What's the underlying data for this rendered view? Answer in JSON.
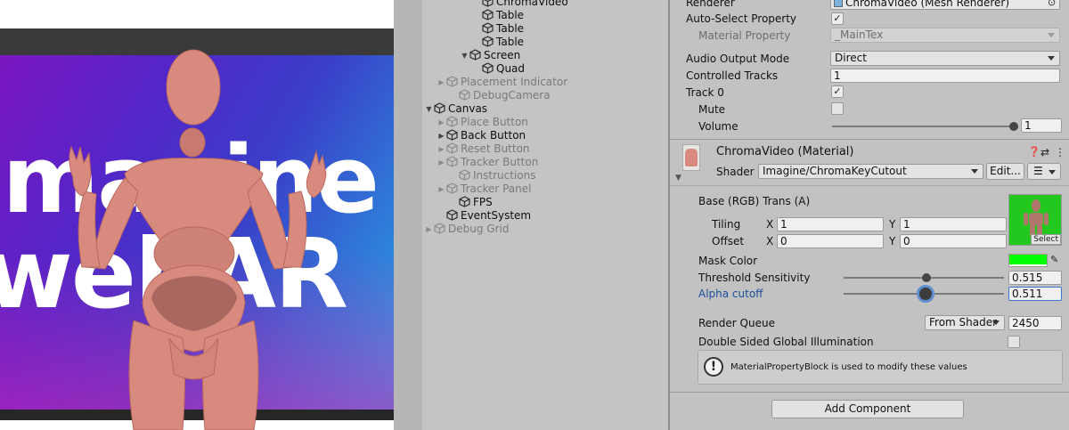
{
  "scene": {
    "overlay_text_line1": "Imagine",
    "overlay_text_line2": "webAR"
  },
  "hierarchy": {
    "items": [
      {
        "label": "ChromaVideo",
        "disabled": false,
        "arrow": "",
        "icon": "cube-icon"
      },
      {
        "label": "Table",
        "disabled": false,
        "arrow": "",
        "icon": "cube-icon"
      },
      {
        "label": "Table",
        "disabled": false,
        "arrow": "",
        "icon": "cube-icon"
      },
      {
        "label": "Table",
        "disabled": false,
        "arrow": "",
        "icon": "cube-icon"
      },
      {
        "label": "Screen",
        "disabled": false,
        "arrow": "expanded",
        "icon": "cube-icon"
      },
      {
        "label": "Quad",
        "disabled": false,
        "arrow": "",
        "icon": "cube-icon"
      },
      {
        "label": "Placement Indicator",
        "disabled": true,
        "arrow": "collapsed",
        "icon": "cube-icon"
      },
      {
        "label": "DebugCamera",
        "disabled": true,
        "arrow": "",
        "icon": "cube-icon"
      },
      {
        "label": "Canvas",
        "disabled": false,
        "arrow": "expanded",
        "icon": "cube-icon"
      },
      {
        "label": "Place Button",
        "disabled": true,
        "arrow": "collapsed",
        "icon": "cube-icon"
      },
      {
        "label": "Back Button",
        "disabled": false,
        "arrow": "collapsed",
        "icon": "cube-icon"
      },
      {
        "label": "Reset Button",
        "disabled": true,
        "arrow": "collapsed",
        "icon": "cube-icon"
      },
      {
        "label": "Tracker Button",
        "disabled": true,
        "arrow": "collapsed",
        "icon": "cube-icon"
      },
      {
        "label": "Instructions",
        "disabled": true,
        "arrow": "",
        "icon": "cube-icon"
      },
      {
        "label": "Tracker Panel",
        "disabled": true,
        "arrow": "collapsed",
        "icon": "cube-icon"
      },
      {
        "label": "FPS",
        "disabled": false,
        "arrow": "",
        "icon": "cube-icon"
      },
      {
        "label": "EventSystem",
        "disabled": false,
        "arrow": "",
        "icon": "cube-icon"
      },
      {
        "label": "Debug Grid",
        "disabled": true,
        "arrow": "collapsed",
        "icon": "cube-icon"
      }
    ]
  },
  "inspector": {
    "renderer_label": "Renderer",
    "renderer_value": "ChromaVideo (Mesh Renderer)",
    "auto_select_label": "Auto-Select Property",
    "auto_select_checked": true,
    "material_property_label": "Material Property",
    "material_property_value": "_MainTex",
    "audio_output_label": "Audio Output Mode",
    "audio_output_value": "Direct",
    "controlled_tracks_label": "Controlled Tracks",
    "controlled_tracks_value": "1",
    "track0_label": "Track 0",
    "track0_checked": true,
    "mute_label": "Mute",
    "mute_checked": false,
    "volume_label": "Volume",
    "volume_value": "1",
    "volume_level": 1.0,
    "material_title": "ChromaVideo (Material)",
    "shader_label": "Shader",
    "shader_value": "Imagine/ChromaKeyCutout",
    "edit_button": "Edit...",
    "base_label": "Base (RGB) Trans (A)",
    "tiling_label": "Tiling",
    "tiling_x": "1",
    "tiling_y": "1",
    "offset_label": "Offset",
    "offset_x": "0",
    "offset_y": "0",
    "x_label": "X",
    "y_label": "Y",
    "select_button": "Select",
    "mask_color_label": "Mask Color",
    "mask_color": "#00ff00",
    "threshold_label": "Threshold Sensitivity",
    "threshold_value": "0.515",
    "threshold_level": 0.515,
    "alpha_cutoff_label": "Alpha cutoff",
    "alpha_cutoff_value": "0.511",
    "alpha_cutoff_level": 0.511,
    "render_queue_label": "Render Queue",
    "render_queue_mode": "From Shader",
    "render_queue_value": "2450",
    "double_sided_label": "Double Sided Global Illumination",
    "double_sided_checked": false,
    "help_text": "MaterialPropertyBlock is used to modify these values",
    "add_component_button": "Add Component"
  },
  "colors": {
    "inspector_bg": "#c2c2c2",
    "hierarchy_bg": "#c4c4c4",
    "focus_blue": "#3a79d2",
    "texture_green": "#22c81e"
  }
}
